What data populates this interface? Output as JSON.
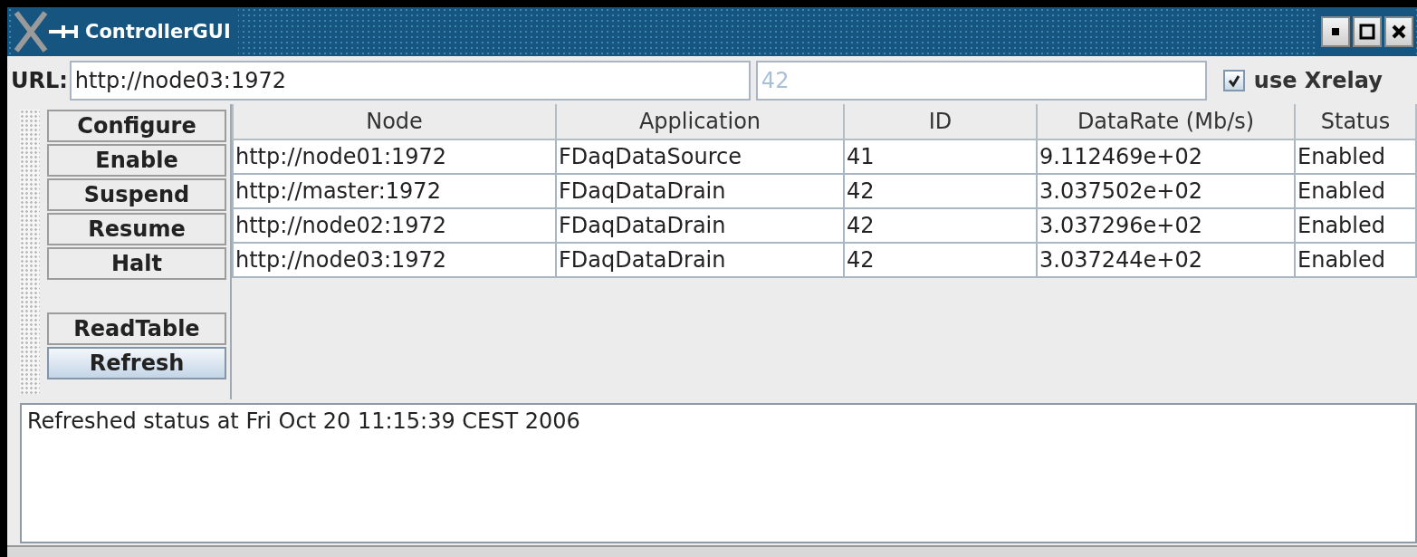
{
  "window": {
    "title": "ControllerGUI"
  },
  "url_bar": {
    "label": "URL:",
    "url": "http://node03:1972",
    "id_field": {
      "value": "42",
      "disabled": true
    },
    "xrelay": {
      "label": "use Xrelay",
      "checked": true
    }
  },
  "buttons": [
    {
      "label": "Configure",
      "highlighted": false
    },
    {
      "label": "Enable",
      "highlighted": false
    },
    {
      "label": "Suspend",
      "highlighted": false
    },
    {
      "label": "Resume",
      "highlighted": false
    },
    {
      "label": "Halt",
      "highlighted": false
    }
  ],
  "table_buttons": [
    {
      "label": "ReadTable",
      "highlighted": false
    },
    {
      "label": "Refresh",
      "highlighted": true
    }
  ],
  "table": {
    "columns": [
      "Node",
      "Application",
      "ID",
      "DataRate (Mb/s)",
      "Status"
    ],
    "rows": [
      [
        "http://node01:1972",
        "FDaqDataSource",
        "41",
        "9.112469e+02",
        "Enabled"
      ],
      [
        "http://master:1972",
        "FDaqDataDrain",
        "42",
        "3.037502e+02",
        "Enabled"
      ],
      [
        "http://node02:1972",
        "FDaqDataDrain",
        "42",
        "3.037296e+02",
        "Enabled"
      ],
      [
        "http://node03:1972",
        "FDaqDataDrain",
        "42",
        "3.037244e+02",
        "Enabled"
      ]
    ]
  },
  "log": "Refreshed status at Fri Oct 20 11:15:39 CEST 2006"
}
